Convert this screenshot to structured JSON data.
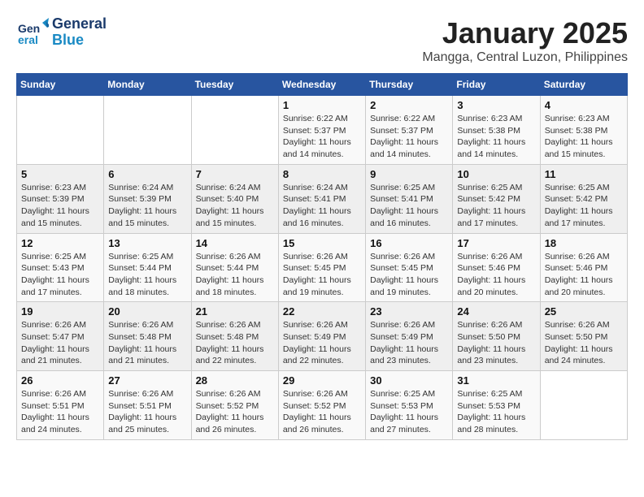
{
  "header": {
    "logo_general": "General",
    "logo_blue": "Blue",
    "month_title": "January 2025",
    "location": "Mangga, Central Luzon, Philippines"
  },
  "weekdays": [
    "Sunday",
    "Monday",
    "Tuesday",
    "Wednesday",
    "Thursday",
    "Friday",
    "Saturday"
  ],
  "weeks": [
    [
      {
        "day": "",
        "sunrise": "",
        "sunset": "",
        "daylight": ""
      },
      {
        "day": "",
        "sunrise": "",
        "sunset": "",
        "daylight": ""
      },
      {
        "day": "",
        "sunrise": "",
        "sunset": "",
        "daylight": ""
      },
      {
        "day": "1",
        "sunrise": "Sunrise: 6:22 AM",
        "sunset": "Sunset: 5:37 PM",
        "daylight": "Daylight: 11 hours and 14 minutes."
      },
      {
        "day": "2",
        "sunrise": "Sunrise: 6:22 AM",
        "sunset": "Sunset: 5:37 PM",
        "daylight": "Daylight: 11 hours and 14 minutes."
      },
      {
        "day": "3",
        "sunrise": "Sunrise: 6:23 AM",
        "sunset": "Sunset: 5:38 PM",
        "daylight": "Daylight: 11 hours and 14 minutes."
      },
      {
        "day": "4",
        "sunrise": "Sunrise: 6:23 AM",
        "sunset": "Sunset: 5:38 PM",
        "daylight": "Daylight: 11 hours and 15 minutes."
      }
    ],
    [
      {
        "day": "5",
        "sunrise": "Sunrise: 6:23 AM",
        "sunset": "Sunset: 5:39 PM",
        "daylight": "Daylight: 11 hours and 15 minutes."
      },
      {
        "day": "6",
        "sunrise": "Sunrise: 6:24 AM",
        "sunset": "Sunset: 5:39 PM",
        "daylight": "Daylight: 11 hours and 15 minutes."
      },
      {
        "day": "7",
        "sunrise": "Sunrise: 6:24 AM",
        "sunset": "Sunset: 5:40 PM",
        "daylight": "Daylight: 11 hours and 15 minutes."
      },
      {
        "day": "8",
        "sunrise": "Sunrise: 6:24 AM",
        "sunset": "Sunset: 5:41 PM",
        "daylight": "Daylight: 11 hours and 16 minutes."
      },
      {
        "day": "9",
        "sunrise": "Sunrise: 6:25 AM",
        "sunset": "Sunset: 5:41 PM",
        "daylight": "Daylight: 11 hours and 16 minutes."
      },
      {
        "day": "10",
        "sunrise": "Sunrise: 6:25 AM",
        "sunset": "Sunset: 5:42 PM",
        "daylight": "Daylight: 11 hours and 17 minutes."
      },
      {
        "day": "11",
        "sunrise": "Sunrise: 6:25 AM",
        "sunset": "Sunset: 5:42 PM",
        "daylight": "Daylight: 11 hours and 17 minutes."
      }
    ],
    [
      {
        "day": "12",
        "sunrise": "Sunrise: 6:25 AM",
        "sunset": "Sunset: 5:43 PM",
        "daylight": "Daylight: 11 hours and 17 minutes."
      },
      {
        "day": "13",
        "sunrise": "Sunrise: 6:25 AM",
        "sunset": "Sunset: 5:44 PM",
        "daylight": "Daylight: 11 hours and 18 minutes."
      },
      {
        "day": "14",
        "sunrise": "Sunrise: 6:26 AM",
        "sunset": "Sunset: 5:44 PM",
        "daylight": "Daylight: 11 hours and 18 minutes."
      },
      {
        "day": "15",
        "sunrise": "Sunrise: 6:26 AM",
        "sunset": "Sunset: 5:45 PM",
        "daylight": "Daylight: 11 hours and 19 minutes."
      },
      {
        "day": "16",
        "sunrise": "Sunrise: 6:26 AM",
        "sunset": "Sunset: 5:45 PM",
        "daylight": "Daylight: 11 hours and 19 minutes."
      },
      {
        "day": "17",
        "sunrise": "Sunrise: 6:26 AM",
        "sunset": "Sunset: 5:46 PM",
        "daylight": "Daylight: 11 hours and 20 minutes."
      },
      {
        "day": "18",
        "sunrise": "Sunrise: 6:26 AM",
        "sunset": "Sunset: 5:46 PM",
        "daylight": "Daylight: 11 hours and 20 minutes."
      }
    ],
    [
      {
        "day": "19",
        "sunrise": "Sunrise: 6:26 AM",
        "sunset": "Sunset: 5:47 PM",
        "daylight": "Daylight: 11 hours and 21 minutes."
      },
      {
        "day": "20",
        "sunrise": "Sunrise: 6:26 AM",
        "sunset": "Sunset: 5:48 PM",
        "daylight": "Daylight: 11 hours and 21 minutes."
      },
      {
        "day": "21",
        "sunrise": "Sunrise: 6:26 AM",
        "sunset": "Sunset: 5:48 PM",
        "daylight": "Daylight: 11 hours and 22 minutes."
      },
      {
        "day": "22",
        "sunrise": "Sunrise: 6:26 AM",
        "sunset": "Sunset: 5:49 PM",
        "daylight": "Daylight: 11 hours and 22 minutes."
      },
      {
        "day": "23",
        "sunrise": "Sunrise: 6:26 AM",
        "sunset": "Sunset: 5:49 PM",
        "daylight": "Daylight: 11 hours and 23 minutes."
      },
      {
        "day": "24",
        "sunrise": "Sunrise: 6:26 AM",
        "sunset": "Sunset: 5:50 PM",
        "daylight": "Daylight: 11 hours and 23 minutes."
      },
      {
        "day": "25",
        "sunrise": "Sunrise: 6:26 AM",
        "sunset": "Sunset: 5:50 PM",
        "daylight": "Daylight: 11 hours and 24 minutes."
      }
    ],
    [
      {
        "day": "26",
        "sunrise": "Sunrise: 6:26 AM",
        "sunset": "Sunset: 5:51 PM",
        "daylight": "Daylight: 11 hours and 24 minutes."
      },
      {
        "day": "27",
        "sunrise": "Sunrise: 6:26 AM",
        "sunset": "Sunset: 5:51 PM",
        "daylight": "Daylight: 11 hours and 25 minutes."
      },
      {
        "day": "28",
        "sunrise": "Sunrise: 6:26 AM",
        "sunset": "Sunset: 5:52 PM",
        "daylight": "Daylight: 11 hours and 26 minutes."
      },
      {
        "day": "29",
        "sunrise": "Sunrise: 6:26 AM",
        "sunset": "Sunset: 5:52 PM",
        "daylight": "Daylight: 11 hours and 26 minutes."
      },
      {
        "day": "30",
        "sunrise": "Sunrise: 6:25 AM",
        "sunset": "Sunset: 5:53 PM",
        "daylight": "Daylight: 11 hours and 27 minutes."
      },
      {
        "day": "31",
        "sunrise": "Sunrise: 6:25 AM",
        "sunset": "Sunset: 5:53 PM",
        "daylight": "Daylight: 11 hours and 28 minutes."
      },
      {
        "day": "",
        "sunrise": "",
        "sunset": "",
        "daylight": ""
      }
    ]
  ]
}
